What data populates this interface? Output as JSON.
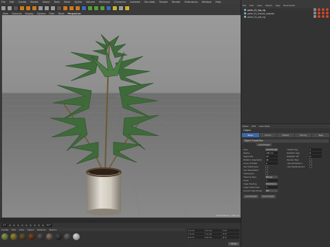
{
  "menubar": {
    "items": [
      "File",
      "Edit",
      "Create",
      "Modes",
      "Select",
      "Tools",
      "Mesh",
      "Spline",
      "Volume",
      "MoGraph",
      "Character",
      "Animate",
      "Simulate",
      "Tracker",
      "Render",
      "Extensions",
      "Window",
      "Help"
    ]
  },
  "viewport": {
    "menu": [
      "View",
      "Cameras",
      "Display",
      "Options",
      "Filter",
      "Panel",
      "Perspective"
    ],
    "active": "Perspective",
    "status": "Grid Spacing : 100 cm"
  },
  "timeline": {
    "frame_start": "0 F",
    "frame_end": "90 F",
    "current": "0 F"
  },
  "materials": {
    "menu": [
      "Create",
      "Edit",
      "View",
      "Select",
      "Material",
      "Texture"
    ],
    "count": 9
  },
  "coords": {
    "rows": [
      [
        "X 0 cm",
        "X 0 cm",
        "H 0°"
      ],
      [
        "Y 0 cm",
        "Y 0 cm",
        "P 0°"
      ],
      [
        "Z 0 cm",
        "Z 0 cm",
        "B 0°"
      ]
    ],
    "apply": "Apply"
  },
  "object_manager": {
    "menu": [
      "File",
      "Edit",
      "View",
      "Object",
      "Tags",
      "Bookmarks"
    ],
    "rows": [
      {
        "label": "palm_01_top_ng",
        "selected": true,
        "tags": 3
      },
      {
        "label": "palm_01_leaves_lowpoly",
        "selected": false,
        "tags": 3
      },
      {
        "label": "palm_01_pot_ng",
        "selected": false,
        "tags": 3
      }
    ]
  },
  "attribute_manager": {
    "menu": [
      "Mode",
      "Edit",
      "User Data"
    ],
    "title": "Object",
    "tabs": [
      "Basic",
      "Coord.",
      "Object",
      "Phong",
      "Tags"
    ],
    "section": "Object Properties",
    "button": "Load Preset",
    "left_params": [
      {
        "label": "Type",
        "value": "Quadrangle",
        "kind": "dropdown"
      },
      {
        "label": "Radius",
        "value": "100 cm",
        "kind": "field"
      },
      {
        "label": "Segments",
        "value": "24",
        "kind": "field"
      },
      {
        "label": "Rotation Segments",
        "value": "24",
        "kind": "field"
      },
      {
        "label": "Level of Detail",
        "value": "1",
        "kind": "field"
      },
      {
        "label": "Use Subdivision",
        "value": "",
        "kind": "check"
      },
      {
        "label": "Use Tessellation",
        "value": "",
        "kind": "check"
      },
      {
        "label": "Subdivision",
        "value": "",
        "kind": "check"
      },
      {
        "label": "Shading Type",
        "value": "Phong",
        "kind": "dropdown"
      },
      {
        "label": "Level",
        "value": "1",
        "kind": "field"
      },
      {
        "label": "Cage Shading",
        "value": "Wireframe",
        "kind": "dropdown"
      },
      {
        "label": "Cage Subdivision",
        "value": "3",
        "kind": "field"
      },
      {
        "label": "Layout Cage Shape",
        "value": "Off",
        "kind": "dropdown"
      }
    ],
    "right_params": [
      {
        "label": "Height Seg.",
        "value": "1",
        "kind": "field"
      },
      {
        "label": "Rotation Seg.",
        "value": "0",
        "kind": "field"
      },
      {
        "label": "Rotation Tilt",
        "value": "0",
        "kind": "field"
      },
      {
        "label": "Render Tess.",
        "value": "",
        "kind": "check"
      },
      {
        "label": "Use Subdivision",
        "value": "",
        "kind": "check"
      },
      {
        "label": "Use Displacement",
        "value": "",
        "kind": "check"
      }
    ],
    "bottom_buttons": [
      "Load Preset",
      "Save Preset"
    ]
  },
  "colors": {
    "accent": "#3a6ab0",
    "panel": "#333333",
    "viewport_sky": "#9a9a9a"
  }
}
